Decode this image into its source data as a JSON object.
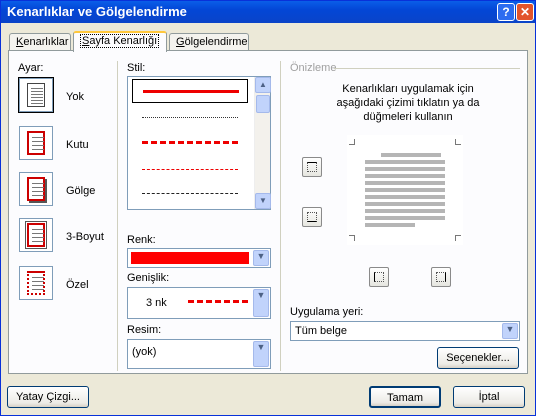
{
  "window": {
    "title": "Kenarlıklar ve Gölgelendirme",
    "help_glyph": "?",
    "close_glyph": "✕"
  },
  "tabs": [
    {
      "label": "Kenarlıklar",
      "underline": "K",
      "rest": "enarlıklar"
    },
    {
      "label": "Sayfa Kenarlığı",
      "underline": "S",
      "rest": "ayfa Kenarlığı"
    },
    {
      "label": "Gölgelendirme",
      "underline": "G",
      "rest": "ölgelendirme"
    }
  ],
  "settings": {
    "heading": "Ayar:",
    "items": [
      {
        "label": "Yok"
      },
      {
        "label": "Kutu"
      },
      {
        "label": "Gölge"
      },
      {
        "label": "3-Boyut"
      },
      {
        "label": "Özel"
      }
    ]
  },
  "style": {
    "heading": "Stil:"
  },
  "color": {
    "heading": "Renk:",
    "value_color": "#ff0000"
  },
  "width": {
    "heading": "Genişlik:",
    "value": "3 nk"
  },
  "art": {
    "heading": "Resim:",
    "value": "(yok)"
  },
  "preview": {
    "heading": "Önizleme",
    "instructions": "Kenarlıkları uygulamak için aşağıdaki çizimi tıklatın ya da düğmeleri kullanın"
  },
  "apply_to": {
    "heading": "Uygulama yeri:",
    "value": "Tüm belge"
  },
  "buttons": {
    "options": "Seçenekler...",
    "horizontal_line": "Yatay Çizgi...",
    "ok": "Tamam",
    "cancel": "İptal"
  },
  "colors": {
    "accent": "#ff0000",
    "titlebar": "#0a5ee8",
    "tab_highlight": "#ffc83c"
  }
}
